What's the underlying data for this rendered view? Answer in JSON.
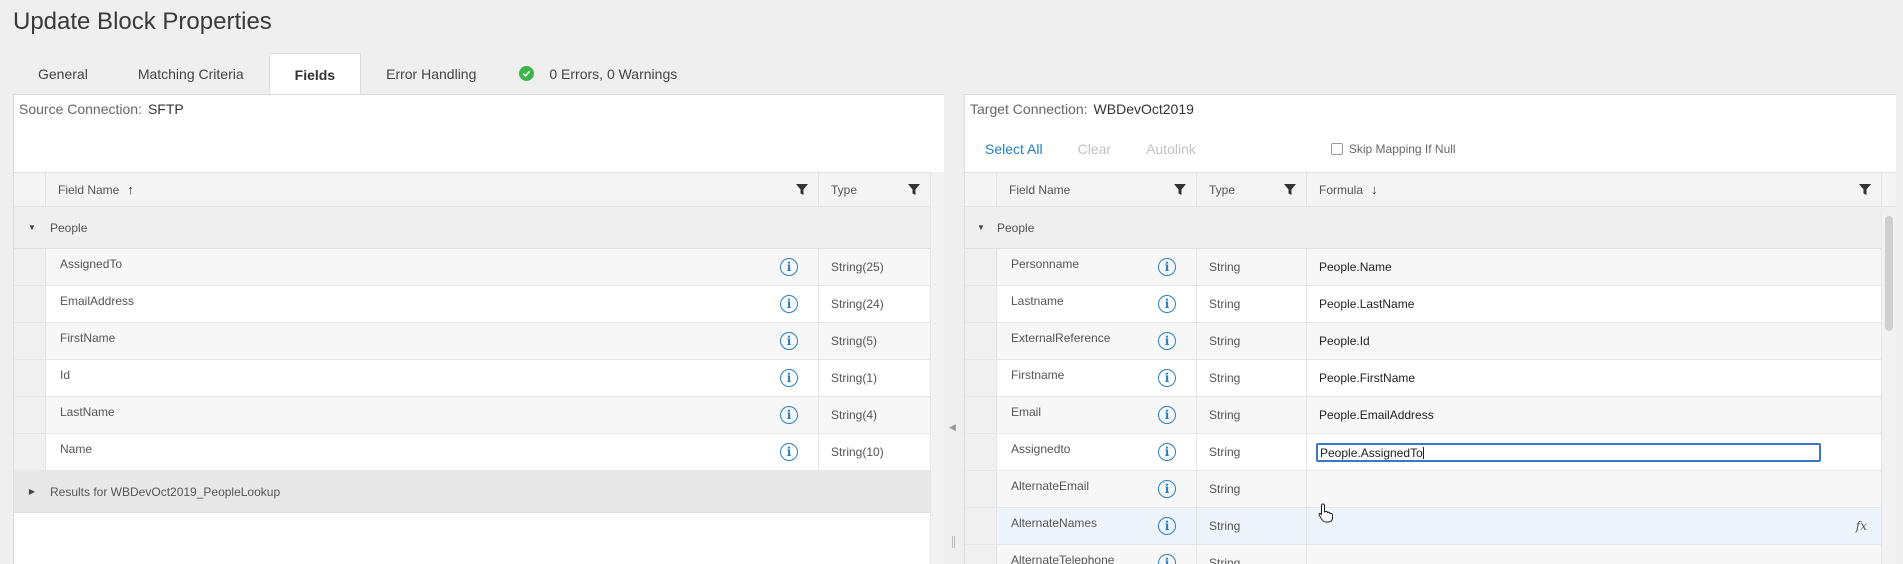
{
  "title": "Update Block Properties",
  "tabs": [
    {
      "label": "General"
    },
    {
      "label": "Matching Criteria"
    },
    {
      "label": "Fields"
    },
    {
      "label": "Error Handling"
    }
  ],
  "status": {
    "text": "0 Errors, 0 Warnings",
    "color": "#3bb44a"
  },
  "source": {
    "label": "Source Connection:",
    "value": "SFTP",
    "columns": {
      "field_name": "Field Name",
      "type": "Type"
    },
    "group": "People",
    "rows": [
      {
        "name": "AssignedTo",
        "type": "String(25)"
      },
      {
        "name": "EmailAddress",
        "type": "String(24)"
      },
      {
        "name": "FirstName",
        "type": "String(5)"
      },
      {
        "name": "Id",
        "type": "String(1)"
      },
      {
        "name": "LastName",
        "type": "String(4)"
      },
      {
        "name": "Name",
        "type": "String(10)"
      }
    ],
    "collapsed_group": "Results for WBDevOct2019_PeopleLookup"
  },
  "target": {
    "label": "Target Connection:",
    "value": "WBDevOct2019",
    "toolbar": {
      "select_all": "Select All",
      "clear": "Clear",
      "autolink": "Autolink",
      "skip_mapping": "Skip Mapping If Null"
    },
    "columns": {
      "field_name": "Field Name",
      "type": "Type",
      "formula": "Formula"
    },
    "group": "People",
    "rows": [
      {
        "name": "Personname",
        "type": "String",
        "formula": "People.Name"
      },
      {
        "name": "Lastname",
        "type": "String",
        "formula": "People.LastName"
      },
      {
        "name": "ExternalReference",
        "type": "String",
        "formula": "People.Id"
      },
      {
        "name": "Firstname",
        "type": "String",
        "formula": "People.FirstName"
      },
      {
        "name": "Email",
        "type": "String",
        "formula": "People.EmailAddress"
      },
      {
        "name": "Assignedto",
        "type": "String",
        "formula": "People.AssignedTo"
      },
      {
        "name": "AlternateEmail",
        "type": "String",
        "formula": ""
      },
      {
        "name": "AlternateNames",
        "type": "String",
        "formula": ""
      },
      {
        "name": "AlternateTelephone",
        "type": "String",
        "formula": ""
      }
    ]
  },
  "icons": {
    "info": "i",
    "fx": "fx",
    "filter": "filter-icon",
    "check": "check-icon"
  }
}
